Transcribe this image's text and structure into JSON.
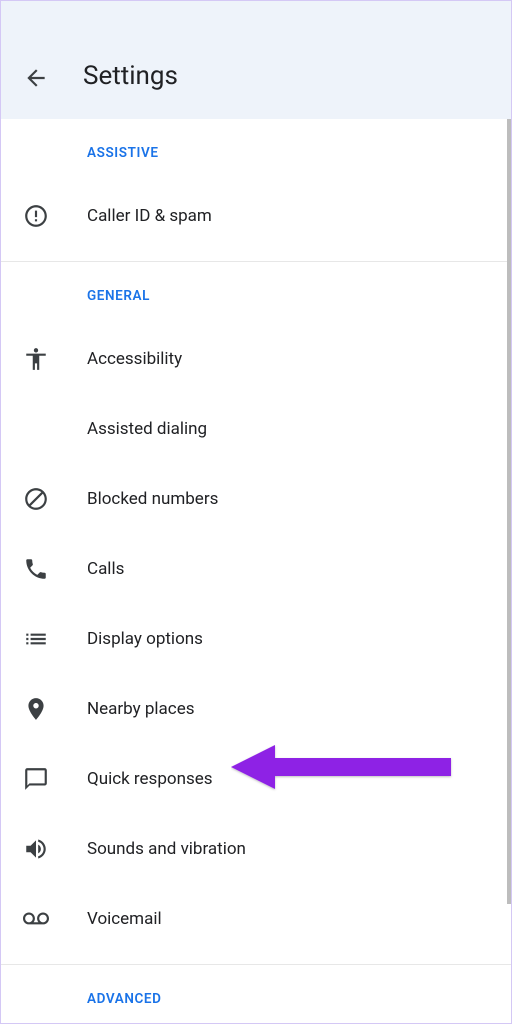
{
  "header": {
    "title": "Settings"
  },
  "sections": {
    "assistive": {
      "label": "ASSISTIVE",
      "items": [
        {
          "label": "Caller ID & spam"
        }
      ]
    },
    "general": {
      "label": "GENERAL",
      "items": [
        {
          "label": "Accessibility"
        },
        {
          "label": "Assisted dialing"
        },
        {
          "label": "Blocked numbers"
        },
        {
          "label": "Calls"
        },
        {
          "label": "Display options"
        },
        {
          "label": "Nearby places"
        },
        {
          "label": "Quick responses"
        },
        {
          "label": "Sounds and vibration"
        },
        {
          "label": "Voicemail"
        }
      ]
    },
    "advanced": {
      "label": "ADVANCED"
    }
  }
}
